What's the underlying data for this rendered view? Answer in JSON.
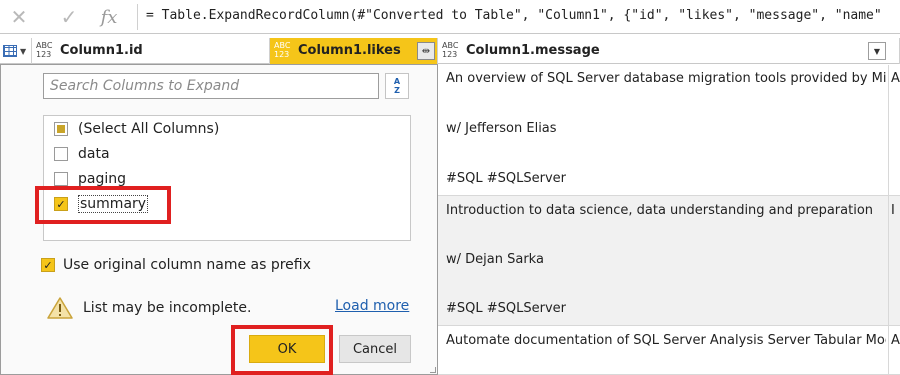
{
  "formula_bar": {
    "cancel_icon": "close-icon",
    "commit_icon": "check-icon",
    "fx_label": "fx",
    "formula": "= Table.ExpandRecordColumn(#\"Converted to Table\", \"Column1\", {\"id\", \"likes\", \"message\", \"name\""
  },
  "columns": [
    {
      "type_top": "ABC",
      "type_bottom": "123",
      "name": "Column1.id"
    },
    {
      "type_top": "ABC",
      "type_bottom": "123",
      "name": "Column1.likes",
      "selected": true
    },
    {
      "type_top": "ABC",
      "type_bottom": "123",
      "name": "Column1.message"
    }
  ],
  "rows": [
    {
      "lines": [
        "An overview of SQL Server database migration tools provided by Micro...",
        "w/ Jefferson Elias",
        "#SQL #SQLServer"
      ],
      "next": "A"
    },
    {
      "lines": [
        "Introduction to data science, data understanding and preparation",
        "w/ Dejan Sarka",
        "#SQL #SQLServer"
      ],
      "next": "I"
    },
    {
      "lines": [
        "Automate documentation of SQL Server Analysis Server Tabular Model",
        "",
        ""
      ],
      "next": "A"
    }
  ],
  "expand_panel": {
    "search_placeholder": "Search Columns to Expand",
    "sort_top": "A",
    "sort_bottom": "Z",
    "items": [
      {
        "label": "(Select All Columns)",
        "state": "partial"
      },
      {
        "label": "data",
        "state": "unchecked"
      },
      {
        "label": "paging",
        "state": "unchecked"
      },
      {
        "label": "summary",
        "state": "checked"
      }
    ],
    "prefix_label": "Use original column name as prefix",
    "prefix_checked": true,
    "warning_text": "List may be incomplete.",
    "load_more": "Load more",
    "ok": "OK",
    "cancel": "Cancel"
  },
  "colors": {
    "accent": "#f5c519",
    "highlight": "#e02020",
    "link": "#1f5fae"
  }
}
